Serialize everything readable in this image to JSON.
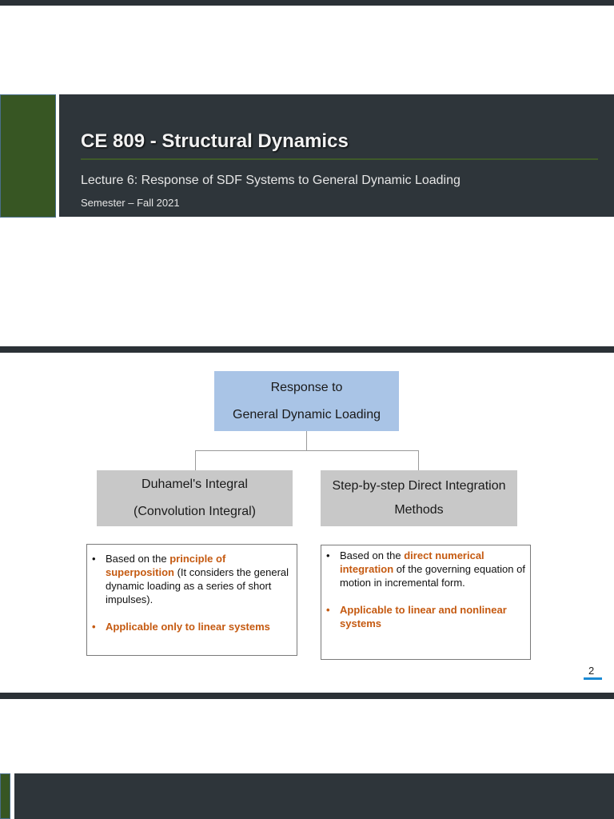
{
  "slide1": {
    "title": "CE 809 - Structural Dynamics",
    "subtitle": "Lecture 6: Response of SDF Systems to General Dynamic Loading",
    "semester": "Semester – Fall 2021"
  },
  "slide2": {
    "root": {
      "line1": "Response to",
      "line2": "General Dynamic Loading"
    },
    "left": {
      "line1": "Duhamel's Integral",
      "line2": "(Convolution Integral)",
      "bullet1": {
        "pre": "Based on the ",
        "highlight": "principle of superposition",
        "post": " (It considers the general dynamic loading as a series of short impulses)."
      },
      "bullet2": "Applicable only to linear systems"
    },
    "right": {
      "line1": "Step-by-step Direct Integration",
      "line2": "Methods",
      "bullet1": {
        "pre": "Based on the ",
        "highlight": "direct numerical integration",
        "post": " of the governing equation of motion in incremental form."
      },
      "bullet2": "Applicable to linear and nonlinear systems"
    },
    "page_number": "2",
    "bullet_char": "•"
  },
  "colors": {
    "dark_band": "#2e353a",
    "accent_green": "#375623",
    "root_node": "#a9c4e6",
    "child_node": "#c8c8c8",
    "highlight_orange": "#c55a11",
    "page_number_underline": "#1a8ad4"
  }
}
